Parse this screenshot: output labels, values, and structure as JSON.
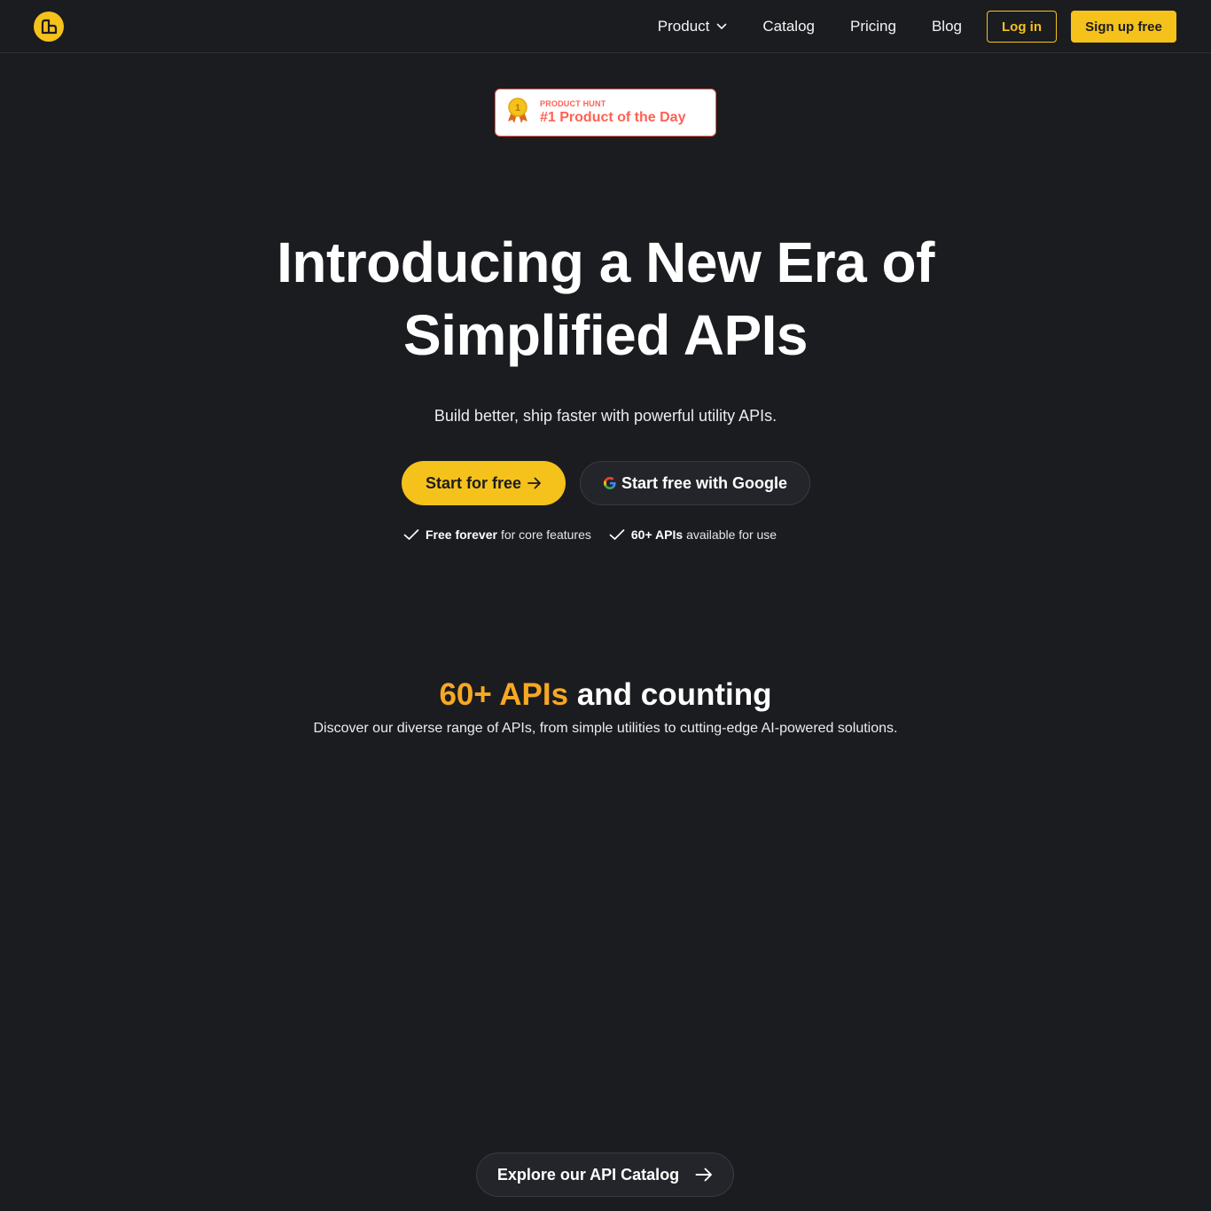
{
  "nav": {
    "logo_icon": "cube-logo-icon",
    "links": [
      {
        "label": "Product",
        "has_dropdown": true
      },
      {
        "label": "Catalog"
      },
      {
        "label": "Pricing"
      },
      {
        "label": "Blog"
      }
    ],
    "login_label": "Log in",
    "signup_label": "Sign up free"
  },
  "badge": {
    "icon": "medal-icon",
    "small": "PRODUCT HUNT",
    "big": "#1 Product of the Day"
  },
  "hero": {
    "title_line1": "Introducing a New Era of",
    "title_line2": "Simplified APIs",
    "subtitle": "Build better, ship faster with powerful utility APIs.",
    "start_label": "Start for free",
    "google_label": "Start free with Google",
    "checks": [
      {
        "bold": "Free forever",
        "text": "for core features"
      },
      {
        "bold": "60+ APIs",
        "text": "available for use"
      }
    ]
  },
  "section": {
    "title_accent": "60+ APIs",
    "title_rest": "and counting",
    "subtitle": "Discover our diverse range of APIs, from simple utilities to cutting-edge AI-powered solutions.",
    "explore_label": "Explore our API Catalog"
  },
  "colors": {
    "background": "#1b1c20",
    "accent": "#f5c21b",
    "accent_orange": "#f7a823",
    "producthunt": "#ff6154"
  }
}
